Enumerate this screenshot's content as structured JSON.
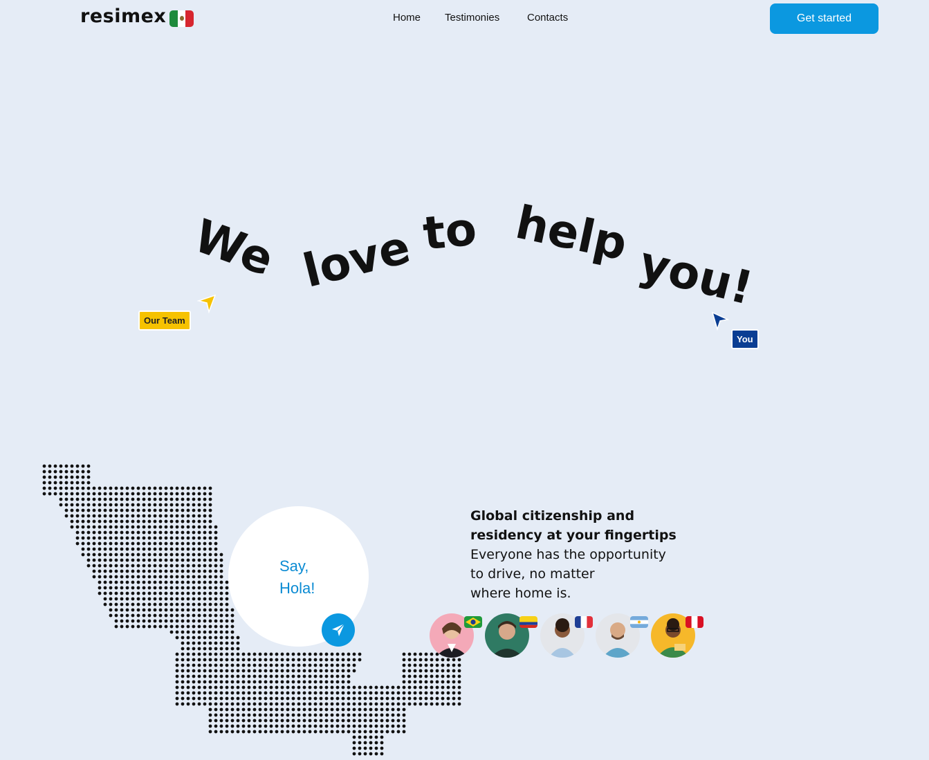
{
  "header": {
    "logo": "resimex",
    "flag_icon": "mexico-flag-icon",
    "nav": [
      "Home",
      "Testimonies",
      "Contacts"
    ],
    "cta": "Get started"
  },
  "hero": {
    "words": [
      "We",
      "love",
      "to",
      "help",
      "you!"
    ],
    "tag_team": "Our Team",
    "tag_you": "You"
  },
  "promo": {
    "bubble_line1": "Say,",
    "bubble_line2": "Hola!",
    "title_line1": "Global citizenship and",
    "title_line2": "residency at your fingertips",
    "body_line1": "Everyone has the opportunity",
    "body_line2": "to drive, no matter",
    "body_line3": "where home is."
  },
  "avatars": [
    {
      "flag": "brazil-flag-icon"
    },
    {
      "flag": "colombia-flag-icon"
    },
    {
      "flag": "france-flag-icon"
    },
    {
      "flag": "argentina-flag-icon"
    },
    {
      "flag": "peru-flag-icon"
    }
  ],
  "colors": {
    "accent": "#0b98e0",
    "background": "#e5ecf6",
    "team_tag": "#f6c200",
    "you_tag": "#0b3e93"
  }
}
